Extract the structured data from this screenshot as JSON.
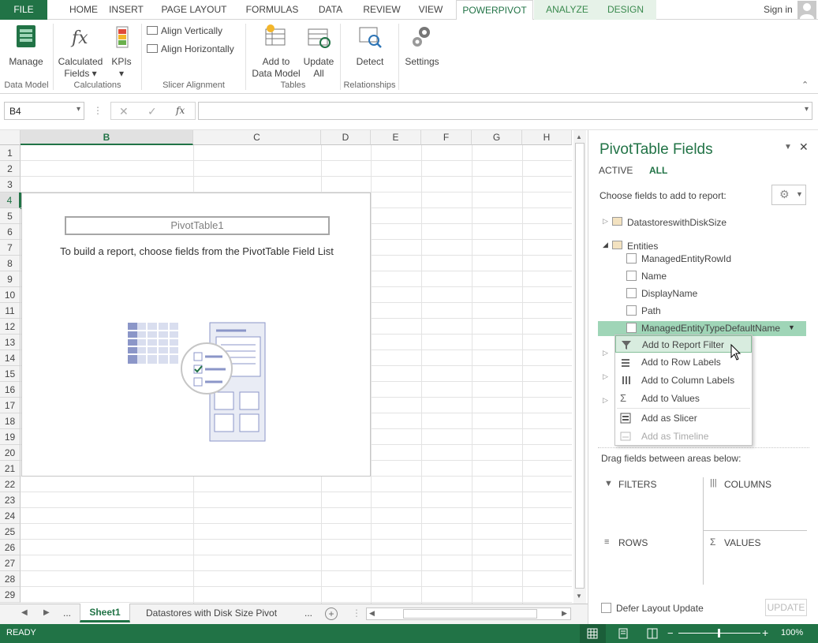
{
  "tabs": {
    "file": "FILE",
    "items": [
      "HOME",
      "INSERT",
      "PAGE LAYOUT",
      "FORMULAS",
      "DATA",
      "REVIEW",
      "VIEW",
      "POWERPIVOT",
      "ANALYZE",
      "DESIGN"
    ],
    "signin": "Sign in"
  },
  "ribbon": {
    "manage": "Manage",
    "calc_fields_1": "Calculated",
    "calc_fields_2": "Fields",
    "kpis": "KPIs",
    "align_vert": "Align Vertically",
    "align_horiz": "Align Horizontally",
    "add_dm_1": "Add to",
    "add_dm_2": "Data Model",
    "update_1": "Update",
    "update_2": "All",
    "detect": "Detect",
    "settings": "Settings",
    "groups": {
      "data_model": "Data Model",
      "calculations": "Calculations",
      "slicer_alignment": "Slicer Alignment",
      "tables": "Tables",
      "relationships": "Relationships"
    }
  },
  "formula_bar": {
    "name_box": "B4",
    "fx": "fx",
    "formula": ""
  },
  "grid": {
    "columns": [
      "B",
      "C",
      "D",
      "E",
      "F",
      "G",
      "H"
    ],
    "rows": [
      "1",
      "2",
      "3",
      "4",
      "5",
      "6",
      "7",
      "8",
      "9",
      "10",
      "11",
      "12",
      "13",
      "14",
      "15",
      "16",
      "17",
      "18",
      "19",
      "20",
      "21",
      "22",
      "23",
      "24",
      "25",
      "26",
      "27",
      "28",
      "29"
    ]
  },
  "pivot": {
    "title": "PivotTable1",
    "message": "To build a report, choose fields from the PivotTable Field List"
  },
  "sheets": {
    "ellipsis_left": "...",
    "active": "Sheet1",
    "other": "Datastores with Disk Size Pivot",
    "ellipsis_right": "..."
  },
  "status": {
    "ready": "READY",
    "zoom": "100%"
  },
  "panel": {
    "title": "PivotTable Fields",
    "tab_active": "ACTIVE",
    "tab_all": "ALL",
    "choose": "Choose fields to add to report:",
    "tables": [
      "DatastoreswithDiskSize",
      "Entities"
    ],
    "fields": [
      "ManagedEntityRowId",
      "Name",
      "DisplayName",
      "Path",
      "ManagedEntityTypeDefaultName"
    ],
    "drag": "Drag fields between areas below:",
    "filters": "FILTERS",
    "columns": "COLUMNS",
    "rows": "ROWS",
    "values": "VALUES",
    "defer": "Defer Layout Update",
    "update": "UPDATE"
  },
  "menu": {
    "items": [
      "Add to Report Filter",
      "Add to Row Labels",
      "Add to Column Labels",
      "Add to Values",
      "Add as Slicer",
      "Add as Timeline"
    ]
  },
  "colors": {
    "accent": "#217346",
    "highlight": "#9fd5b7",
    "menu_hover": "#d8ecdf"
  }
}
